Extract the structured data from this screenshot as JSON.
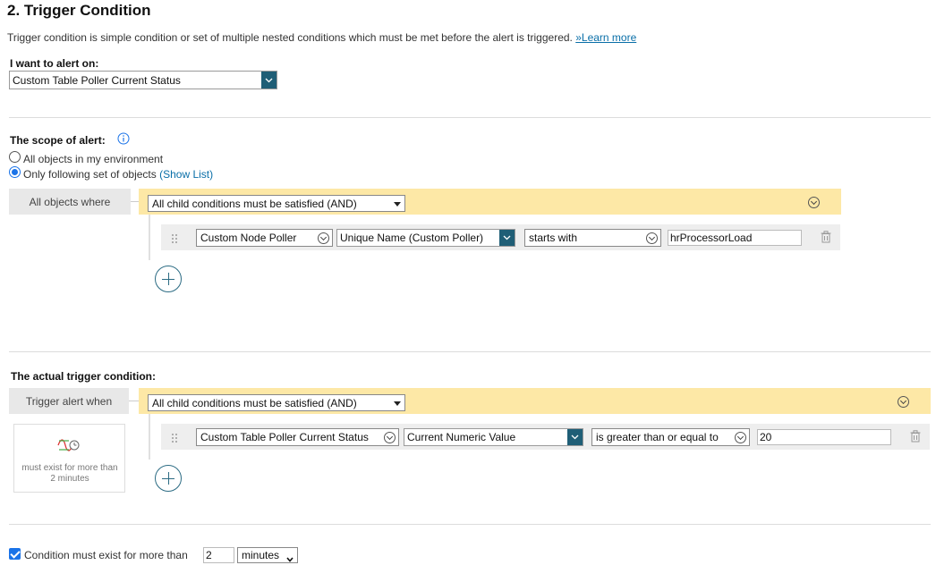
{
  "header": {
    "title": "2. Trigger Condition",
    "description": "Trigger condition is simple condition or set of multiple nested conditions which must be met before the alert is triggered.",
    "learn_more": "»Learn more"
  },
  "alert_on": {
    "label": "I want to alert on:",
    "value": "Custom Table Poller Current Status"
  },
  "scope": {
    "label": "The scope of alert:",
    "option_all": "All objects in my environment",
    "option_following": "Only following set of objects",
    "show_list": "(Show List)",
    "selected": "Only following set of objects",
    "box_label": "All objects where",
    "group_operator": "All child conditions must be satisfied (AND)",
    "condition": {
      "field1": "Custom Node Poller",
      "field2": "Unique Name (Custom Poller)",
      "operator": "starts with",
      "value": "hrProcessorLoad"
    }
  },
  "trigger": {
    "label": "The actual trigger condition:",
    "box_label": "Trigger alert when",
    "group_operator": "All child conditions must be satisfied (AND)",
    "duration_note": "must exist for more than 2 minutes",
    "condition": {
      "field1": "Custom Table Poller Current Status",
      "field2": "Current Numeric Value",
      "operator": "is greater than or equal to",
      "value": "20"
    }
  },
  "footer": {
    "checkbox_label": "Condition must exist for more than",
    "checked": true,
    "duration_value": "2",
    "unit": "minutes"
  },
  "colors": {
    "accent": "#1f5e76",
    "link": "#0a6fa8",
    "group_bar": "#fde8a6",
    "row_bar": "#eeeeee"
  }
}
